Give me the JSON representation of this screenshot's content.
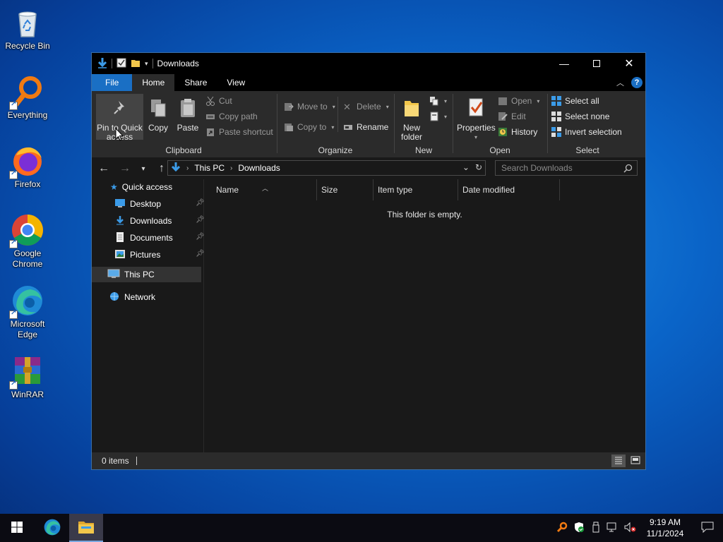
{
  "desktop": {
    "icons": [
      {
        "label": "Recycle Bin",
        "icon": "recycle-bin-icon"
      },
      {
        "label": "Everything",
        "icon": "everything-search-icon"
      },
      {
        "label": "Firefox",
        "icon": "firefox-icon"
      },
      {
        "label": "Google Chrome",
        "icon": "chrome-icon"
      },
      {
        "label": "Microsoft Edge",
        "icon": "edge-icon"
      },
      {
        "label": "WinRAR",
        "icon": "winrar-icon"
      }
    ]
  },
  "window": {
    "title": "Downloads",
    "tabs": [
      "File",
      "Home",
      "Share",
      "View"
    ],
    "help": "?",
    "ribbon": {
      "clipboard": {
        "label": "Clipboard",
        "pin": "Pin to Quick access",
        "pin_line1": "Pin to Quick",
        "pin_line2": "access",
        "copy": "Copy",
        "paste": "Paste",
        "cut": "Cut",
        "copy_path": "Copy path",
        "paste_shortcut": "Paste shortcut"
      },
      "organize": {
        "label": "Organize",
        "move_to": "Move to",
        "copy_to": "Copy to",
        "delete": "Delete",
        "rename": "Rename"
      },
      "new": {
        "label": "New",
        "new_folder_line1": "New",
        "new_folder_line2": "folder"
      },
      "open": {
        "label": "Open",
        "properties": "Properties",
        "open": "Open",
        "edit": "Edit",
        "history": "History"
      },
      "select": {
        "label": "Select",
        "select_all": "Select all",
        "select_none": "Select none",
        "invert_selection": "Invert selection"
      }
    },
    "address": {
      "path": [
        "This PC",
        "Downloads"
      ],
      "search_placeholder": "Search Downloads"
    },
    "nav_pane": {
      "quick_access": "Quick access",
      "pinned": [
        "Desktop",
        "Downloads",
        "Documents",
        "Pictures"
      ],
      "this_pc": "This PC",
      "network": "Network"
    },
    "columns": [
      "Name",
      "Size",
      "Item type",
      "Date modified"
    ],
    "empty_message": "This folder is empty.",
    "status": "0 items"
  },
  "taskbar": {
    "time": "9:19 AM",
    "date": "11/1/2024"
  },
  "colors": {
    "accent": "#1a6fc4",
    "window_bg": "#191919",
    "ribbon_bg": "#2b2b2b"
  }
}
